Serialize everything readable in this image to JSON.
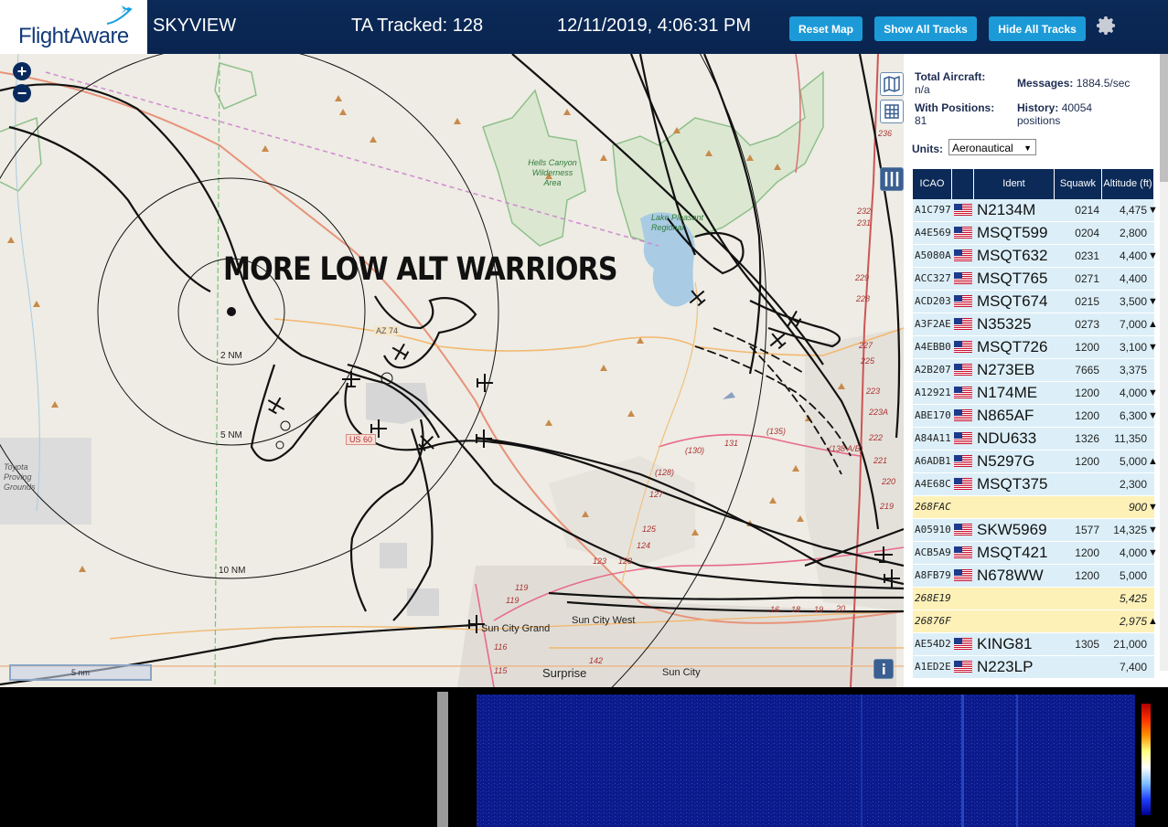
{
  "header": {
    "logo": "FlightAware",
    "title": "SKYVIEW",
    "tracked": "TA Tracked: 128",
    "datetime": "12/11/2019, 4:06:31 PM",
    "buttons": {
      "reset_map": "Reset Map",
      "show_all_tracks": "Show All Tracks",
      "hide_all_tracks": "Hide All Tracks"
    }
  },
  "map": {
    "overlay_text": "MORE LOW ALT WARRIORS",
    "zoom_in": "+",
    "zoom_out": "−",
    "scale_label": "5 nm",
    "range_labels": [
      "2 NM",
      "5 NM",
      "10 NM"
    ],
    "place_labels": {
      "hells_canyon": "Hells Canyon Wilderness Area",
      "lake_pleasant": "Lake Pleasant Regional",
      "toyota": "Toyota Proving Grounds",
      "az74": "AZ 74",
      "us60": "US 60",
      "sun_city_grand": "Sun City Grand",
      "sun_city_west": "Sun City West",
      "surprise": "Surprise",
      "sun_city": "Sun City"
    },
    "road_numbers": [
      "236",
      "232",
      "231",
      "229",
      "228",
      "227",
      "225",
      "223",
      "223A",
      "222",
      "221",
      "220",
      "219",
      "(135)",
      "(130)",
      "131",
      "(138 A/B)",
      "(128)",
      "127",
      "125",
      "124",
      "123",
      "123",
      "119",
      "119",
      "116",
      "115",
      "142",
      "16",
      "18",
      "19",
      "20"
    ]
  },
  "stats": {
    "total_aircraft_label": "Total Aircraft:",
    "total_aircraft_value": "n/a",
    "messages_label": "Messages:",
    "messages_value": "1884.5/sec",
    "with_positions_label": "With Positions:",
    "with_positions_value": "81",
    "history_label": "History:",
    "history_value": "40054 positions",
    "units_label": "Units:",
    "units_value": "Aeronautical"
  },
  "table": {
    "headers": [
      "ICAO",
      "",
      "Ident",
      "Squawk",
      "Altitude (ft)"
    ],
    "rows": [
      {
        "icao": "A1C797",
        "flag": true,
        "ident": "N2134M",
        "squawk": "0214",
        "alt": "4,475",
        "trend": "▼",
        "style": "blue"
      },
      {
        "icao": "A4E569",
        "flag": true,
        "ident": "MSQT599",
        "squawk": "0204",
        "alt": "2,800",
        "trend": "",
        "style": "blue"
      },
      {
        "icao": "A5080A",
        "flag": true,
        "ident": "MSQT632",
        "squawk": "0231",
        "alt": "4,400",
        "trend": "▼",
        "style": "blue"
      },
      {
        "icao": "ACC327",
        "flag": true,
        "ident": "MSQT765",
        "squawk": "0271",
        "alt": "4,400",
        "trend": "",
        "style": "blue"
      },
      {
        "icao": "ACD203",
        "flag": true,
        "ident": "MSQT674",
        "squawk": "0215",
        "alt": "3,500",
        "trend": "▼",
        "style": "blue"
      },
      {
        "icao": "A3F2AE",
        "flag": true,
        "ident": "N35325",
        "squawk": "0273",
        "alt": "7,000",
        "trend": "▲",
        "style": "blue"
      },
      {
        "icao": "A4EBB0",
        "flag": true,
        "ident": "MSQT726",
        "squawk": "1200",
        "alt": "3,100",
        "trend": "▼",
        "style": "blue"
      },
      {
        "icao": "A2B207",
        "flag": true,
        "ident": "N273EB",
        "squawk": "7665",
        "alt": "3,375",
        "trend": "",
        "style": "blue"
      },
      {
        "icao": "A12921",
        "flag": true,
        "ident": "N174ME",
        "squawk": "1200",
        "alt": "4,000",
        "trend": "▼",
        "style": "blue"
      },
      {
        "icao": "ABE170",
        "flag": true,
        "ident": "N865AF",
        "squawk": "1200",
        "alt": "6,300",
        "trend": "▼",
        "style": "blue"
      },
      {
        "icao": "A84A11",
        "flag": true,
        "ident": "NDU633",
        "squawk": "1326",
        "alt": "11,350",
        "trend": "",
        "style": "blue"
      },
      {
        "icao": "A6ADB1",
        "flag": true,
        "ident": "N5297G",
        "squawk": "1200",
        "alt": "5,000",
        "trend": "▲",
        "style": "blue"
      },
      {
        "icao": "A4E68C",
        "flag": true,
        "ident": "MSQT375",
        "squawk": "",
        "alt": "2,300",
        "trend": "",
        "style": "blue"
      },
      {
        "icao": "268FAC",
        "flag": false,
        "ident": "",
        "squawk": "",
        "alt": "900",
        "trend": "▼",
        "style": "yellow"
      },
      {
        "icao": "A05910",
        "flag": true,
        "ident": "SKW5969",
        "squawk": "1577",
        "alt": "14,325",
        "trend": "▼",
        "style": "blue"
      },
      {
        "icao": "ACB5A9",
        "flag": true,
        "ident": "MSQT421",
        "squawk": "1200",
        "alt": "4,000",
        "trend": "▼",
        "style": "blue"
      },
      {
        "icao": "A8FB79",
        "flag": true,
        "ident": "N678WW",
        "squawk": "1200",
        "alt": "5,000",
        "trend": "",
        "style": "blue"
      },
      {
        "icao": "268E19",
        "flag": false,
        "ident": "",
        "squawk": "",
        "alt": "5,425",
        "trend": "",
        "style": "yellow"
      },
      {
        "icao": "26876F",
        "flag": false,
        "ident": "",
        "squawk": "",
        "alt": "2,975",
        "trend": "▲",
        "style": "yellow"
      },
      {
        "icao": "AE54D2",
        "flag": true,
        "ident": "KING81",
        "squawk": "1305",
        "alt": "21,000",
        "trend": "",
        "style": "blue"
      },
      {
        "icao": "A1ED2E",
        "flag": true,
        "ident": "N223LP",
        "squawk": "",
        "alt": "7,400",
        "trend": "",
        "style": "blue"
      }
    ]
  },
  "icons": {
    "gear": "gear-icon",
    "map_layers": "map-icon",
    "grid": "grid-icon",
    "columns": "columns-icon",
    "info": "info-icon"
  },
  "colors": {
    "header_bg": "#0b2a57",
    "button_bg": "#1c9ad8",
    "row_blue": "#dceff8",
    "row_yellow": "#fdf1b8"
  }
}
